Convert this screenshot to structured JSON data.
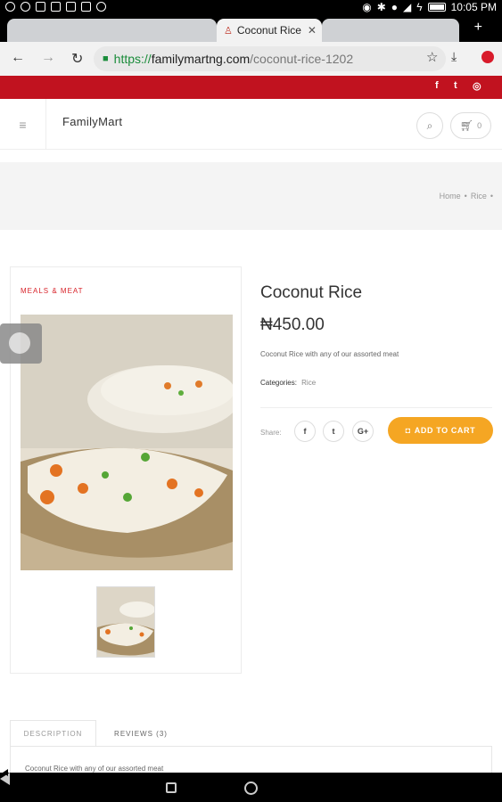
{
  "status_bar": {
    "time": "10:05 PM"
  },
  "browser": {
    "active_tab_title": "Coconut Rice",
    "url": {
      "scheme": "https://",
      "host": "familymartng.com",
      "path": "/coconut-rice-1202"
    }
  },
  "social": {
    "facebook": "f",
    "twitter": "t",
    "instagram": "◎"
  },
  "site": {
    "brand": "FamilyMart",
    "cart_count": "0"
  },
  "breadcrumb": [
    "Home",
    "Rice"
  ],
  "product": {
    "category_tag": "MEALS & MEAT",
    "title": "Coconut Rice",
    "price": "₦450.00",
    "short_description": "Coconut Rice with any of our assorted meat",
    "categories_label": "Categories:",
    "category": "Rice",
    "share_label": "Share:",
    "share_facebook": "f",
    "share_twitter": "t",
    "share_google": "G+",
    "add_to_cart": "ADD TO CART"
  },
  "tabs": {
    "description": "DESCRIPTION",
    "reviews": "REVIEWS (3)",
    "description_text": "Coconut Rice with any of our assorted meat"
  },
  "colors": {
    "brand_red": "#c1121f",
    "cart_orange": "#f5a623"
  }
}
